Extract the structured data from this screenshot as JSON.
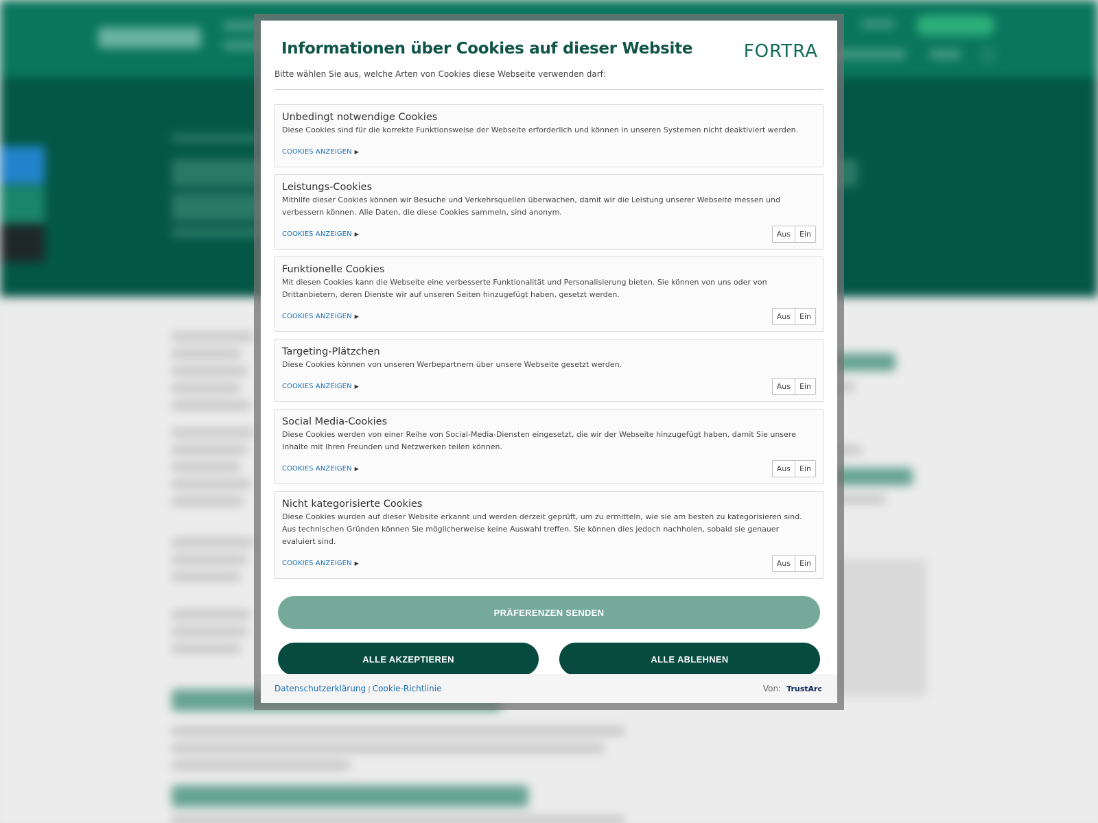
{
  "modal": {
    "title": "Informationen über Cookies auf dieser Website",
    "brand": "FORTRA",
    "subtitle": "Bitte wählen Sie aus, welche Arten von Cookies diese Webseite verwenden darf:"
  },
  "categories": [
    {
      "title": "Unbedingt notwendige Cookies",
      "description": "Diese Cookies sind für die korrekte Funktionsweise der Webseite erforderlich und können in unseren Systemen nicht deaktiviert werden.",
      "link": "COOKIES ANZEIGEN"
    },
    {
      "title": "Leistungs-Cookies",
      "description": "Mithilfe dieser Cookies können wir Besuche und Verkehrsquellen überwachen, damit wir die Leistung unserer Webseite messen und verbessern können. Alle Daten, die diese Cookies sammeln, sind anonym.",
      "link": "COOKIES ANZEIGEN",
      "toggle_off": "Aus",
      "toggle_on": "Ein"
    },
    {
      "title": "Funktionelle Cookies",
      "description": "Mit diesen Cookies kann die Webseite eine verbesserte Funktionalität und Personalisierung bieten. Sie können von uns oder von Drittanbietern, deren Dienste wir auf unseren Seiten hinzugefügt haben, gesetzt werden.",
      "link": "COOKIES ANZEIGEN",
      "toggle_off": "Aus",
      "toggle_on": "Ein"
    },
    {
      "title": "Targeting-Plätzchen",
      "description": "Diese Cookies können von unseren Werbepartnern über unsere Webseite gesetzt werden.",
      "link": "COOKIES ANZEIGEN",
      "toggle_off": "Aus",
      "toggle_on": "Ein"
    },
    {
      "title": "Social Media-Cookies",
      "description": "Diese Cookies werden von einer Reihe von Social-Media-Diensten eingesetzt, die wir der Webseite hinzugefügt haben, damit Sie unsere Inhalte mit Ihren Freunden und Netzwerken teilen können.",
      "link": "COOKIES ANZEIGEN",
      "toggle_off": "Aus",
      "toggle_on": "Ein"
    },
    {
      "title": "Nicht kategorisierte Cookies",
      "description": "Diese Cookies wurden auf dieser Website erkannt und werden derzeit geprüft, um zu ermitteln, wie sie am besten zu kategorisieren sind. Aus technischen Gründen können Sie möglicherweise keine Auswahl treffen. Sie können dies jedoch nachholen, sobald sie genauer evaluiert sind.",
      "link": "COOKIES ANZEIGEN",
      "toggle_off": "Aus",
      "toggle_on": "Ein"
    }
  ],
  "buttons": {
    "preferences": "PRÄFERENZEN SENDEN",
    "accept_all": "ALLE AKZEPTIEREN",
    "reject_all": "ALLE ABLEHNEN"
  },
  "footer": {
    "privacy": "Datenschutzerklärung",
    "separator": "|",
    "cookie_policy": "Cookie-Richtlinie",
    "powered_by": "Von:",
    "provider": "TrustArc"
  },
  "colors": {
    "brand_dark": "#064a40",
    "brand_light": "#75aa9a",
    "link": "#1a6fb5",
    "title": "#0f5446"
  }
}
